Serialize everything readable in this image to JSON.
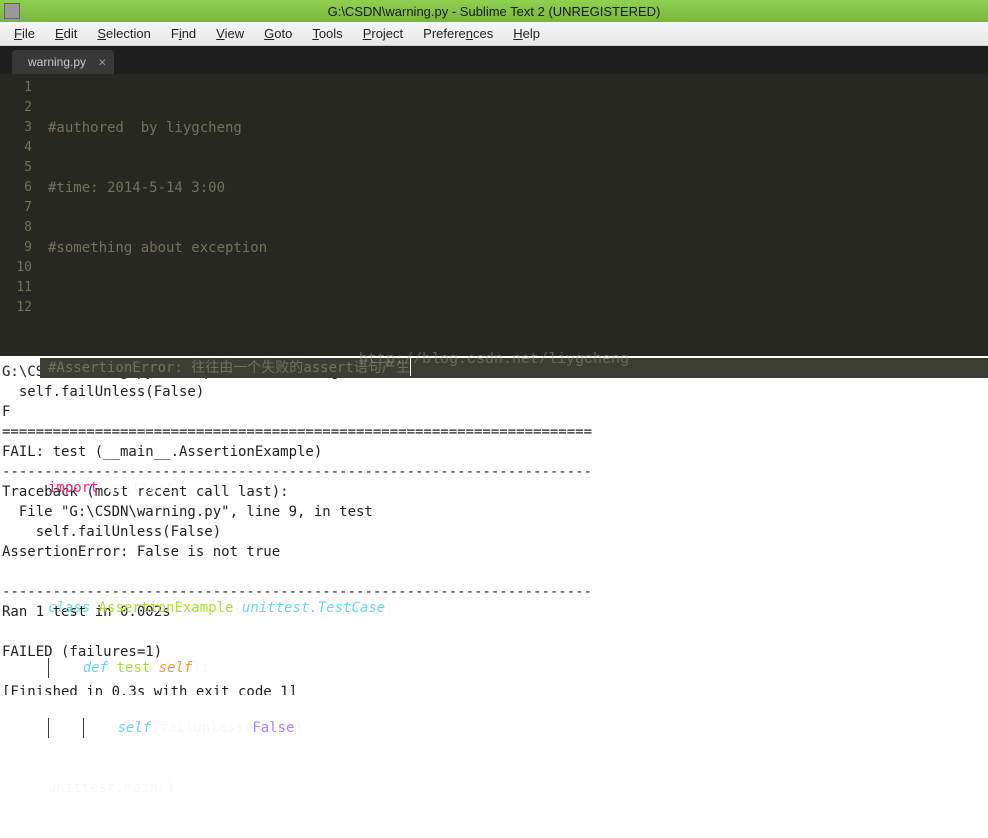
{
  "window": {
    "title": "G:\\CSDN\\warning.py - Sublime Text 2 (UNREGISTERED)"
  },
  "menubar": {
    "items": [
      "File",
      "Edit",
      "Selection",
      "Find",
      "View",
      "Goto",
      "Tools",
      "Project",
      "Preferences",
      "Help"
    ]
  },
  "tabs": [
    {
      "label": "warning.py"
    }
  ],
  "editor": {
    "line_numbers": [
      "1",
      "2",
      "3",
      "4",
      "5",
      "6",
      "7",
      "8",
      "9",
      "10",
      "11",
      "12"
    ],
    "code": {
      "l1": "#authored  by liygcheng",
      "l2": "#time: 2014-5-14 3:00",
      "l3": "#something about exception",
      "l5": "#AssertionError: 往往由一个失败的assert语句产生",
      "l7_import": "import",
      "l7_mod": " unittest",
      "l9_class": "class",
      "l9_name": " AssertionExample",
      "l9_paren_open": "(",
      "l9_base": "unittest.TestCase",
      "l9_end": "):",
      "l10_def": "def",
      "l10_name": " test",
      "l10_paren_open": "(",
      "l10_self": "self",
      "l10_end": "):",
      "l11_self": "self",
      "l11_dot_fn": ".failUnless(",
      "l11_const": "False",
      "l11_close": ")",
      "l12": "unittest.main()"
    },
    "cursor_line": 5
  },
  "watermark": "http://blog.csdn.net/liygcheng",
  "console_output": "G:\\CSDN\\warning.py:9: DeprecationWarning: Please use assertTrue instead.\n  self.failUnless(False)\nF\n======================================================================\nFAIL: test (__main__.AssertionExample)\n----------------------------------------------------------------------\nTraceback (most recent call last):\n  File \"G:\\CSDN\\warning.py\", line 9, in test\n    self.failUnless(False)\nAssertionError: False is not true\n\n----------------------------------------------------------------------\nRan 1 test in 0.002s\n\nFAILED (failures=1)\n\n[Finished in 0.3s with exit code 1]"
}
